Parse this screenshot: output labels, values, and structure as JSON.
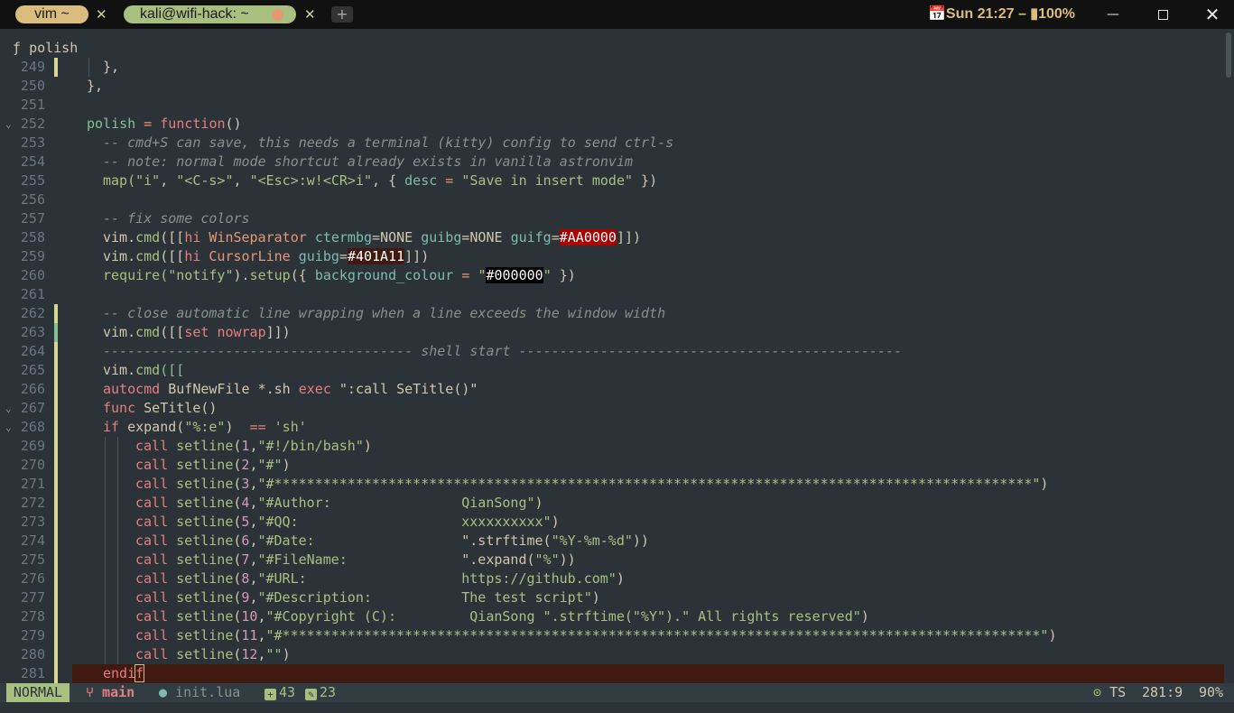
{
  "tabs": [
    {
      "label": "vim ~"
    },
    {
      "label": "kali@wifi-hack: ~"
    }
  ],
  "new_tab_label": "+",
  "clock": "Sun 21:27 – ",
  "battery": "100%",
  "winbar": {
    "icon": "ƒ",
    "label": "polish"
  },
  "lines": [
    {
      "n": "249"
    },
    {
      "n": "250"
    },
    {
      "n": "251"
    },
    {
      "n": "252"
    },
    {
      "n": "253"
    },
    {
      "n": "254"
    },
    {
      "n": "255"
    },
    {
      "n": "256"
    },
    {
      "n": "257"
    },
    {
      "n": "258"
    },
    {
      "n": "259"
    },
    {
      "n": "260"
    },
    {
      "n": "261"
    },
    {
      "n": "262"
    },
    {
      "n": "263"
    },
    {
      "n": "264"
    },
    {
      "n": "265"
    },
    {
      "n": "266"
    },
    {
      "n": "267"
    },
    {
      "n": "268"
    },
    {
      "n": "269"
    },
    {
      "n": "270"
    },
    {
      "n": "271"
    },
    {
      "n": "272"
    },
    {
      "n": "273"
    },
    {
      "n": "274"
    },
    {
      "n": "275"
    },
    {
      "n": "276"
    },
    {
      "n": "277"
    },
    {
      "n": "278"
    },
    {
      "n": "279"
    },
    {
      "n": "280"
    },
    {
      "n": "281"
    }
  ],
  "code": {
    "l249": "},",
    "l250": "},",
    "l252": [
      "polish",
      " = ",
      "function",
      "()"
    ],
    "l253": "-- cmd+S can save, this needs a terminal (kitty) config to send ctrl-s",
    "l254": "-- note: normal mode shortcut already exists in vanilla astronvim",
    "l255": [
      "map(",
      "\"i\"",
      ", ",
      "\"<C-s>\"",
      ", ",
      "\"<Esc>:w!<CR>i\"",
      ", { ",
      "desc",
      " = ",
      "\"Save in insert mode\"",
      " })"
    ],
    "l257": "-- fix some colors",
    "l258": [
      "vim.",
      "cmd",
      "([[",
      "hi",
      " ",
      "WinSeparator",
      " ",
      "ctermbg",
      "=",
      "NONE",
      " ",
      "guibg",
      "=",
      "NONE",
      " ",
      "guifg",
      "=",
      "#AA0000",
      "]])"
    ],
    "l259": [
      "vim.",
      "cmd",
      "([[",
      "hi",
      " ",
      "CursorLine",
      " ",
      "guibg",
      "=",
      "#401A11",
      "]])"
    ],
    "l260": [
      "require(",
      "\"notify\"",
      ").",
      "setup",
      "({ ",
      "background_colour",
      " = ",
      "\"",
      "#000000",
      "\"",
      " })"
    ],
    "l262": "-- close automatic line wrapping when a line exceeds the window width",
    "l263": [
      "vim.",
      "cmd",
      "([[",
      "set",
      " ",
      "nowrap",
      "]])"
    ],
    "l264": "-------------------------------------- shell start -----------------------------------------------",
    "l265": [
      "vim.",
      "cmd",
      "([["
    ],
    "l266": [
      "autocmd",
      " BufNewFile *.sh ",
      "exec",
      " ",
      "\":call SeTitle()\""
    ],
    "l267": [
      "func",
      " ",
      "SeTitle()"
    ],
    "l268": [
      "if",
      " expand(",
      "\"%:e\"",
      ")  ",
      "==",
      " ",
      "'sh'"
    ],
    "l269": [
      "call",
      " ",
      "setline",
      "(",
      "1",
      ",",
      "\"#!/bin/bash\"",
      ")"
    ],
    "l270": [
      "call",
      " ",
      "setline",
      "(",
      "2",
      ",",
      "\"#\"",
      ")"
    ],
    "l271": [
      "call",
      " ",
      "setline",
      "(",
      "3",
      ",",
      "\"#*********************************************************************************************\"",
      ")"
    ],
    "l272": [
      "call",
      " ",
      "setline",
      "(",
      "4",
      ",",
      "\"#Author:                ",
      "QianSong\"",
      ")"
    ],
    "l273": [
      "call",
      " ",
      "setline",
      "(",
      "5",
      ",",
      "\"#QQ:                    ",
      "xxxxxxxxxx\"",
      ")"
    ],
    "l274": [
      "call",
      " ",
      "setline",
      "(",
      "6",
      ",",
      "\"#Date:                  ",
      "\".strftime(",
      "\"%Y-%m-%d\"",
      "))"
    ],
    "l275": [
      "call",
      " ",
      "setline",
      "(",
      "7",
      ",",
      "\"#FileName:              ",
      "\".expand(",
      "\"%\"",
      "))"
    ],
    "l276": [
      "call",
      " ",
      "setline",
      "(",
      "8",
      ",",
      "\"#URL:                   ",
      "https://github.com\"",
      ")"
    ],
    "l277": [
      "call",
      " ",
      "setline",
      "(",
      "9",
      ",",
      "\"#Description:           ",
      "The test script\"",
      ")"
    ],
    "l278": [
      "call",
      " ",
      "setline",
      "(",
      "10",
      ",",
      "\"#Copyright (C):         ",
      "QianSong \".strftime(",
      "\"%Y\"",
      ").\" All rights reserved\"",
      ")"
    ],
    "l279": [
      "call",
      " ",
      "setline",
      "(",
      "11",
      ",",
      "\"#*********************************************************************************************\"",
      ")"
    ],
    "l280": [
      "call",
      " ",
      "setline",
      "(",
      "12",
      ",",
      "\"\"",
      ")"
    ],
    "l281": [
      "endi",
      "f"
    ]
  },
  "status": {
    "mode": "NORMAL",
    "branch": "main",
    "file": "init.lua",
    "added": "43",
    "changed": "23",
    "ts": "TS",
    "position": "281:9",
    "percent": "90%"
  },
  "colors": {
    "background": "#2b3339",
    "cursorline": "#401a11",
    "mode_bg": "#a7c080",
    "tab_vim": "#dbbc7f",
    "tab_kali": "#a7c080"
  }
}
